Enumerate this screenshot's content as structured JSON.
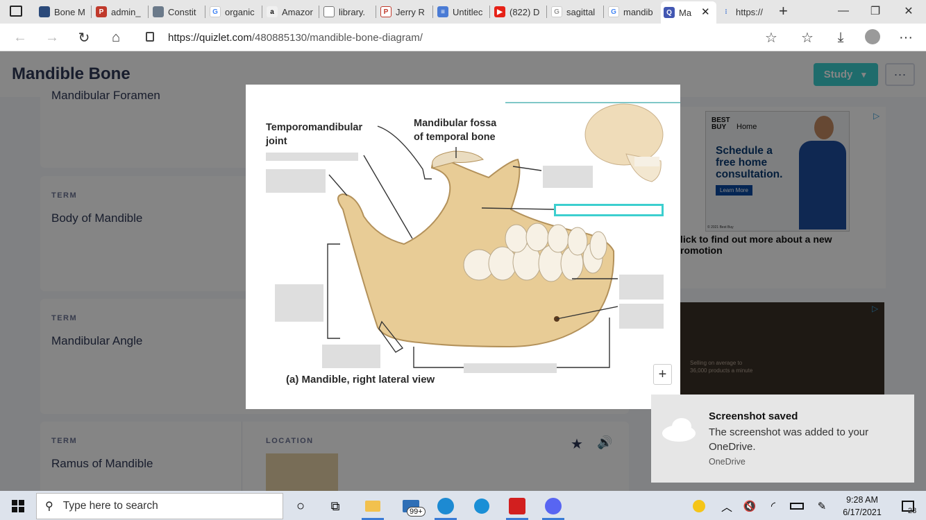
{
  "browser": {
    "tabs": [
      {
        "label": "Bone M",
        "color": "#2b4a7a"
      },
      {
        "label": "admin_",
        "color": "#c0392b"
      },
      {
        "label": "Constit",
        "color": "#6b7a8a"
      },
      {
        "label": "organic",
        "color": "#4285f4"
      },
      {
        "label": "Amazor",
        "color": "#f0f0f0"
      },
      {
        "label": "library.",
        "color": "#f0f0f0"
      },
      {
        "label": "Jerry R",
        "color": "#c0392b"
      },
      {
        "label": "Untitlec",
        "color": "#4a7bd5"
      },
      {
        "label": "(822) D",
        "color": "#e62117"
      },
      {
        "label": "sagittal",
        "color": "#4285f4"
      },
      {
        "label": "mandib",
        "color": "#4285f4"
      },
      {
        "label": "Ma",
        "color": "#4257b2"
      },
      {
        "label": "https://",
        "color": "#4a7bd5"
      }
    ],
    "new_tab": "+",
    "url_domain": "https://quizlet.com",
    "url_path": "/480885130/mandible-bone-diagram/"
  },
  "header": {
    "title": "Mandible Bone",
    "study_label": "Study",
    "more_label": "···"
  },
  "cards": {
    "c0": {
      "term": "Mandibular Foramen"
    },
    "c1": {
      "label": "TERM",
      "term": "Body of Mandible"
    },
    "c2": {
      "label": "TERM",
      "term": "Mandibular Angle"
    },
    "c3": {
      "label": "TERM",
      "term": "Ramus of Mandible",
      "location_label": "LOCATION"
    }
  },
  "ad": {
    "brand": "BEST BUY",
    "home": "Home",
    "headline_1": "Schedule a",
    "headline_2": "free home",
    "headline_3": "consultation.",
    "cta": "Learn More",
    "copyright": "© 2021 Best Buy",
    "caption_1": "lick to find out more about a new",
    "caption_2": "romotion",
    "video_text_1": "Selling on average to",
    "video_text_2": "36,000 products a minute"
  },
  "diagram": {
    "label_tmj_1": "Temporomandibular",
    "label_tmj_2": "joint",
    "label_fossa_1": "Mandibular fossa",
    "label_fossa_2": "of temporal bone",
    "caption": "(a) Mandible, right lateral view",
    "zoom_plus": "+"
  },
  "toast": {
    "title": "Screenshot saved",
    "body": "The screenshot was added to your OneDrive.",
    "source": "OneDrive"
  },
  "taskbar": {
    "search_placeholder": "Type here to search",
    "mail_badge": "99+",
    "time": "9:28 AM",
    "date": "6/17/2021",
    "notif_count": "28"
  }
}
